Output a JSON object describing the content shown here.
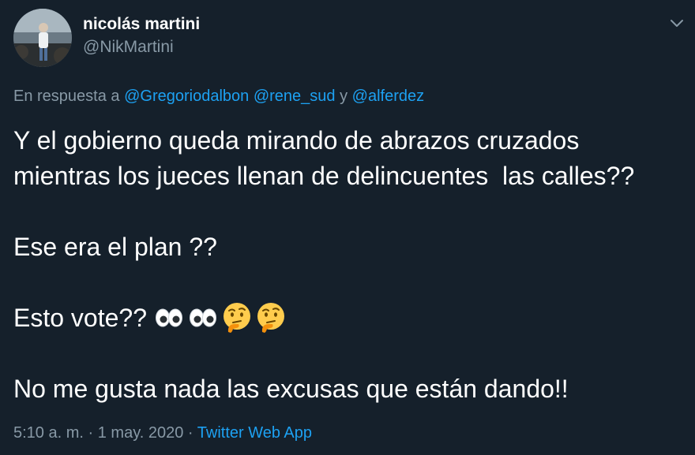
{
  "user": {
    "name": "nicolás martini",
    "handle": "@NikMartini"
  },
  "reply": {
    "prefix": "En respuesta a",
    "mentions": [
      "@Gregoriodalbon",
      "@rene_sud"
    ],
    "joiner": "y",
    "last_mention": "@alferdez"
  },
  "tweet": {
    "line1": "Y el gobierno queda mirando de abrazos cruzados",
    "line2": "mientras los jueces llenan de delincuentes  las calles??",
    "line3": "Ese era el plan ??",
    "line4": "Esto vote??",
    "line5": "No me gusta nada las excusas que están dando!!",
    "emojis": [
      "eyes-emoji",
      "eyes-emoji",
      "thinking-face-emoji",
      "thinking-face-emoji"
    ]
  },
  "meta": {
    "time": "5:10 a. m.",
    "separator": "·",
    "date": "1 may. 2020",
    "source": "Twitter Web App"
  },
  "colors": {
    "background": "#15202b",
    "secondary_text": "#8899a6",
    "link": "#1da1f2",
    "primary_text": "#ffffff"
  }
}
